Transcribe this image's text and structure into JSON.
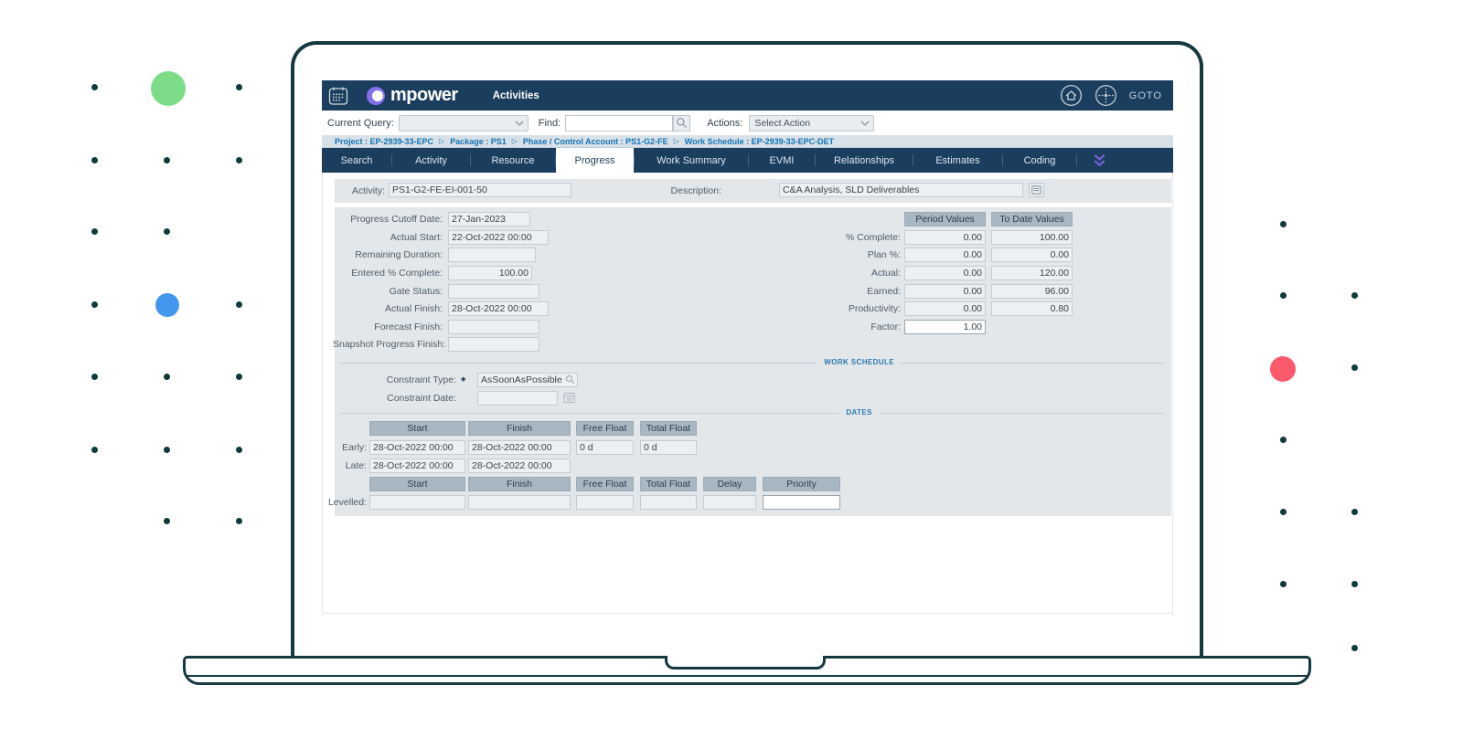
{
  "decor": {
    "green_circle": "#7ddc87",
    "blue_circle": "#4496ef",
    "red_circle": "#fb5a6d",
    "dot_color": "#0e3a3a"
  },
  "icons": {
    "calendar": "calendar-icon",
    "home": "home-icon",
    "goto_target": "goto-target-icon",
    "magnifier": "magnifier-icon",
    "notes": "notes-icon",
    "date_picker": "date-picker-icon",
    "expand_tabs": "expand-tabs-icon",
    "dropdown_chevron": "chevron-down-icon",
    "breadcrumb_separator": "▷"
  },
  "header": {
    "logo": "mpower",
    "title": "Activities",
    "goto": "GOTO"
  },
  "toolbar": {
    "current_query_label": "Current Query:",
    "current_query_value": "",
    "find_label": "Find:",
    "find_value": "",
    "actions_label": "Actions:",
    "actions_value": "Select Action"
  },
  "breadcrumb": [
    "Project : EP-2939-33-EPC",
    "Package : PS1",
    "Phase / Control Account : PS1-G2-FE",
    "Work Schedule : EP-2939-33-EPC-DET"
  ],
  "tabs": [
    "Search",
    "Activity",
    "Resource",
    "Progress",
    "Work Summary",
    "EVMI",
    "Relationships",
    "Estimates",
    "Coding"
  ],
  "active_tab": "Progress",
  "activity_bar": {
    "activity_label": "Activity:",
    "activity_value": "PS1-G2-FE-EI-001-50",
    "description_label": "Description:",
    "description_value": "C&A Analysis, SLD Deliverables"
  },
  "progress": {
    "fields": [
      {
        "label": "Progress Cutoff Date:",
        "value": "27-Jan-2023"
      },
      {
        "label": "Actual Start:",
        "value": "22-Oct-2022 00:00"
      },
      {
        "label": "Remaining Duration:",
        "value": ""
      },
      {
        "label": "Entered % Complete:",
        "value": "100.00"
      },
      {
        "label": "Gate Status:",
        "value": ""
      },
      {
        "label": "Actual Finish:",
        "value": "28-Oct-2022 00:00"
      },
      {
        "label": "Forecast Finish:",
        "value": ""
      },
      {
        "label": "Snapshot Progress Finish:",
        "value": ""
      }
    ],
    "value_columns": {
      "period": "Period Values",
      "todate": "To Date Values"
    },
    "value_rows": [
      {
        "label": "% Complete:",
        "period": "0.00",
        "todate": "100.00"
      },
      {
        "label": "Plan %:",
        "period": "0.00",
        "todate": "0.00"
      },
      {
        "label": "Actual:",
        "period": "0.00",
        "todate": "120.00"
      },
      {
        "label": "Earned:",
        "period": "0.00",
        "todate": "96.00"
      },
      {
        "label": "Productivity:",
        "period": "0.00",
        "todate": "0.80"
      },
      {
        "label": "Factor:",
        "period": "1.00"
      }
    ]
  },
  "sections": {
    "work_schedule": "WORK SCHEDULE",
    "dates": "DATES"
  },
  "constraint": {
    "type_label": "Constraint Type:",
    "required_marker": "◆",
    "type_value": "AsSoonAsPossible",
    "date_label": "Constraint Date:",
    "date_value": ""
  },
  "dates": {
    "headers": [
      "Start",
      "Finish",
      "Free Float",
      "Total Float"
    ],
    "early_label": "Early:",
    "early": {
      "start": "28-Oct-2022 00:00",
      "finish": "28-Oct-2022 00:00",
      "free_float": "0 d",
      "total_float": "0 d"
    },
    "late_label": "Late:",
    "late": {
      "start": "28-Oct-2022 00:00",
      "finish": "28-Oct-2022 00:00"
    },
    "levelled_headers": [
      "Start",
      "Finish",
      "Free Float",
      "Total Float",
      "Delay",
      "Priority"
    ],
    "levelled_label": "Levelled:",
    "levelled": {
      "start": "",
      "finish": "",
      "free_float": "",
      "total_float": "",
      "delay": "",
      "priority": ""
    }
  }
}
